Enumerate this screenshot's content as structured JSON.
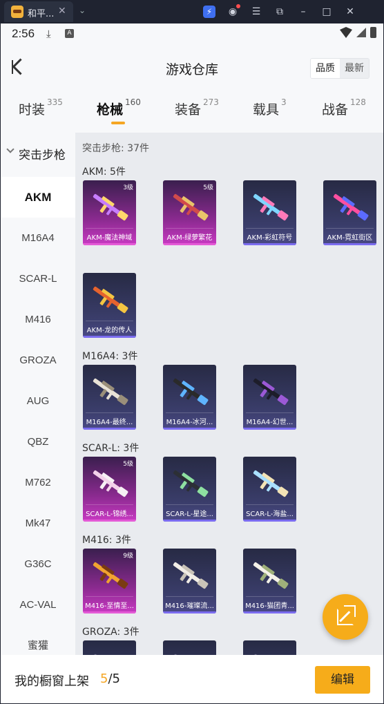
{
  "window": {
    "tab_title": "和平...",
    "close": "✕",
    "dropdown": "⌄"
  },
  "status": {
    "time": "2:56",
    "download": "⤓",
    "a_badge": "A"
  },
  "header": {
    "title": "游戏仓库",
    "sort": [
      "品质",
      "最新"
    ]
  },
  "tabs": [
    {
      "label": "时装",
      "count": "335"
    },
    {
      "label": "枪械",
      "count": "160"
    },
    {
      "label": "装备",
      "count": "273"
    },
    {
      "label": "载具",
      "count": "3"
    },
    {
      "label": "战备",
      "count": "128"
    }
  ],
  "sidebar": {
    "group": "突击步枪",
    "items": [
      "AKM",
      "M16A4",
      "SCAR-L",
      "M416",
      "GROZA",
      "AUG",
      "QBZ",
      "M762",
      "Mk47",
      "G36C",
      "AC-VAL",
      "蜜獾"
    ]
  },
  "content": {
    "category_title": "突击步枪: 37件",
    "sections": [
      {
        "title": "AKM: 5件",
        "items": [
          {
            "name": "AKM-魔法神域",
            "level": "3级",
            "rarity": "pink",
            "colors": [
              "#c77dff",
              "#ffd86b"
            ]
          },
          {
            "name": "AKM-绿萝繁花",
            "level": "5级",
            "rarity": "pink",
            "colors": [
              "#d14b4b",
              "#e9c46a"
            ]
          },
          {
            "name": "AKM-彩虹符号",
            "level": "",
            "rarity": "blue",
            "colors": [
              "#7fd6ff",
              "#ff7ab8"
            ]
          },
          {
            "name": "AKM-霓虹街区",
            "level": "",
            "rarity": "blue",
            "colors": [
              "#ff4fa0",
              "#5b6bff"
            ]
          },
          {
            "name": "AKM-龙的传人",
            "level": "",
            "rarity": "blue",
            "colors": [
              "#e5632e",
              "#f4c542"
            ]
          }
        ]
      },
      {
        "title": "M16A4: 3件",
        "items": [
          {
            "name": "M16A4-最终...",
            "level": "",
            "rarity": "blue",
            "colors": [
              "#e8e2d6",
              "#9a8f7a"
            ]
          },
          {
            "name": "M16A4-冰河...",
            "level": "",
            "rarity": "blue",
            "colors": [
              "#2a2a2a",
              "#5fb4ff"
            ]
          },
          {
            "name": "M16A4-幻世...",
            "level": "",
            "rarity": "blue",
            "colors": [
              "#1d1d2a",
              "#9b59d6"
            ]
          }
        ]
      },
      {
        "title": "SCAR-L: 3件",
        "items": [
          {
            "name": "SCAR-L-锦绣...",
            "level": "5级",
            "rarity": "pink",
            "colors": [
              "#f3d1ea",
              "#f6f0f4"
            ]
          },
          {
            "name": "SCAR-L-星途...",
            "level": "",
            "rarity": "blue",
            "colors": [
              "#2c2f35",
              "#8ee0a1"
            ]
          },
          {
            "name": "SCAR-L-海盐...",
            "level": "",
            "rarity": "blue",
            "colors": [
              "#a9e0ff",
              "#f3e3b5"
            ]
          }
        ]
      },
      {
        "title": "M416: 3件",
        "items": [
          {
            "name": "M416-至情至...",
            "level": "9级",
            "rarity": "pink",
            "colors": [
              "#f1a330",
              "#7a3b12"
            ]
          },
          {
            "name": "M416-璀璨流...",
            "level": "",
            "rarity": "blue",
            "colors": [
              "#f1ede6",
              "#c9c3b8"
            ]
          },
          {
            "name": "M416-猫团青...",
            "level": "",
            "rarity": "blue",
            "colors": [
              "#f4f1e8",
              "#9fb07a"
            ]
          }
        ]
      },
      {
        "title": "GROZA: 3件",
        "items": [
          {
            "name": "",
            "level": "",
            "rarity": "blue",
            "colors": [
              "#6b6b8a",
              "#9a9ac2"
            ]
          },
          {
            "name": "",
            "level": "",
            "rarity": "blue",
            "colors": [
              "#6b6b8a",
              "#9a9ac2"
            ]
          },
          {
            "name": "",
            "level": "",
            "rarity": "blue",
            "colors": [
              "#6b6b8a",
              "#9a9ac2"
            ]
          }
        ]
      }
    ]
  },
  "bottom": {
    "label": "我的橱窗上架",
    "count_current": "5",
    "count_total": "/5",
    "edit": "编辑"
  },
  "colors": {
    "accent": "#f6ac1a",
    "pink_rarity": "#e45ad6",
    "blue_rarity": "#7b6cf0"
  }
}
